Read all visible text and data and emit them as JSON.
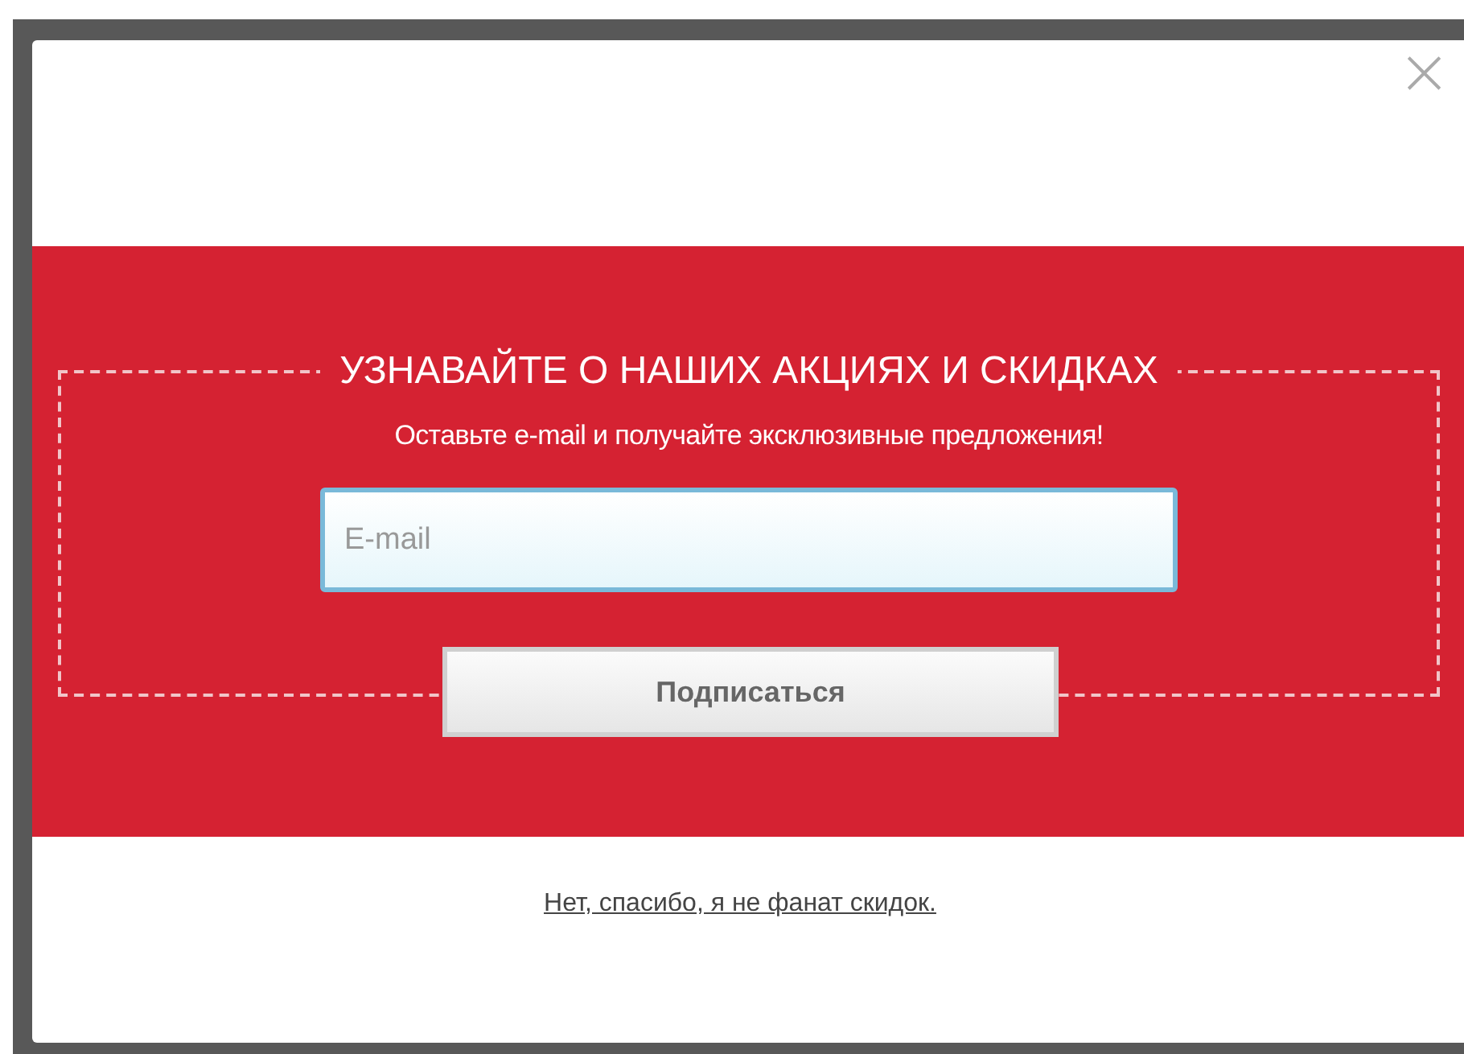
{
  "dialog": {
    "close": "×",
    "title": "УЗНАВАЙТЕ О НАШИХ АКЦИЯХ И СКИДКАХ",
    "subtitle": "Оставьте e-mail и получайте эксклюзивные предложения!",
    "email": {
      "placeholder": "E-mail"
    },
    "subscribe_button": "Подписаться",
    "decline_link": "Нет, спасибо, я не фанат скидок."
  }
}
